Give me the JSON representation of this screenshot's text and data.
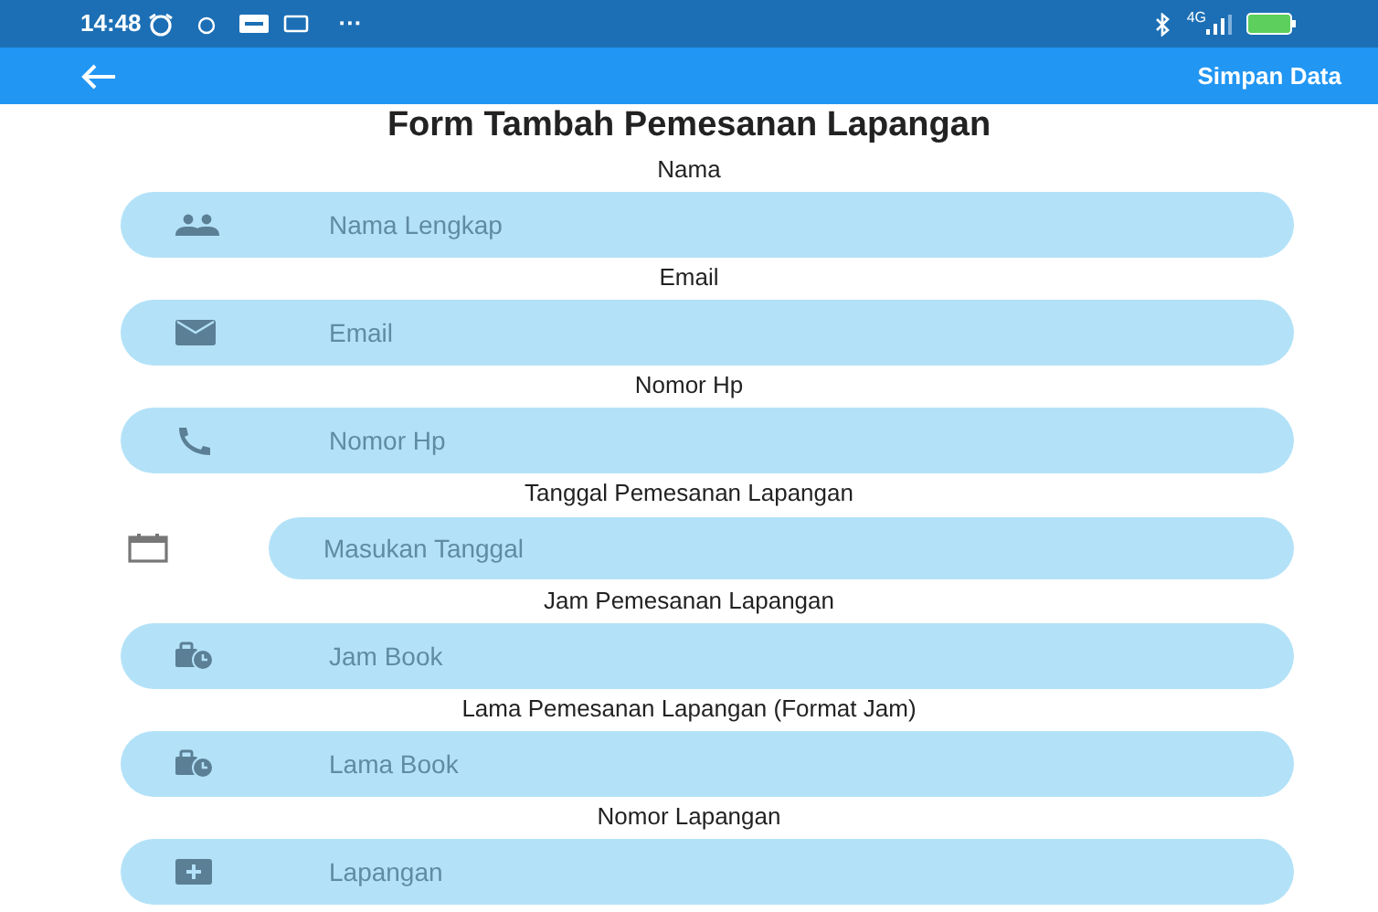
{
  "status_bar": {
    "time": "14:48",
    "more": "···",
    "network": "4G"
  },
  "app_bar": {
    "action": "Simpan Data"
  },
  "title": "Form Tambah Pemesanan Lapangan",
  "fields": [
    {
      "label": "Nama",
      "placeholder": "Nama Lengkap",
      "kind": "name"
    },
    {
      "label": "Email",
      "placeholder": "Email",
      "kind": "email"
    },
    {
      "label": "Nomor Hp",
      "placeholder": "Nomor Hp",
      "kind": "phone"
    },
    {
      "label": "Tanggal Pemesanan Lapangan",
      "placeholder": "Masukan Tanggal",
      "kind": "date"
    },
    {
      "label": "Jam Pemesanan Lapangan",
      "placeholder": "Jam Book",
      "kind": "time"
    },
    {
      "label": "Lama Pemesanan Lapangan (Format Jam)",
      "placeholder": "Lama Book",
      "kind": "time"
    },
    {
      "label": "Nomor Lapangan",
      "placeholder": "Lapangan",
      "kind": "number"
    }
  ]
}
